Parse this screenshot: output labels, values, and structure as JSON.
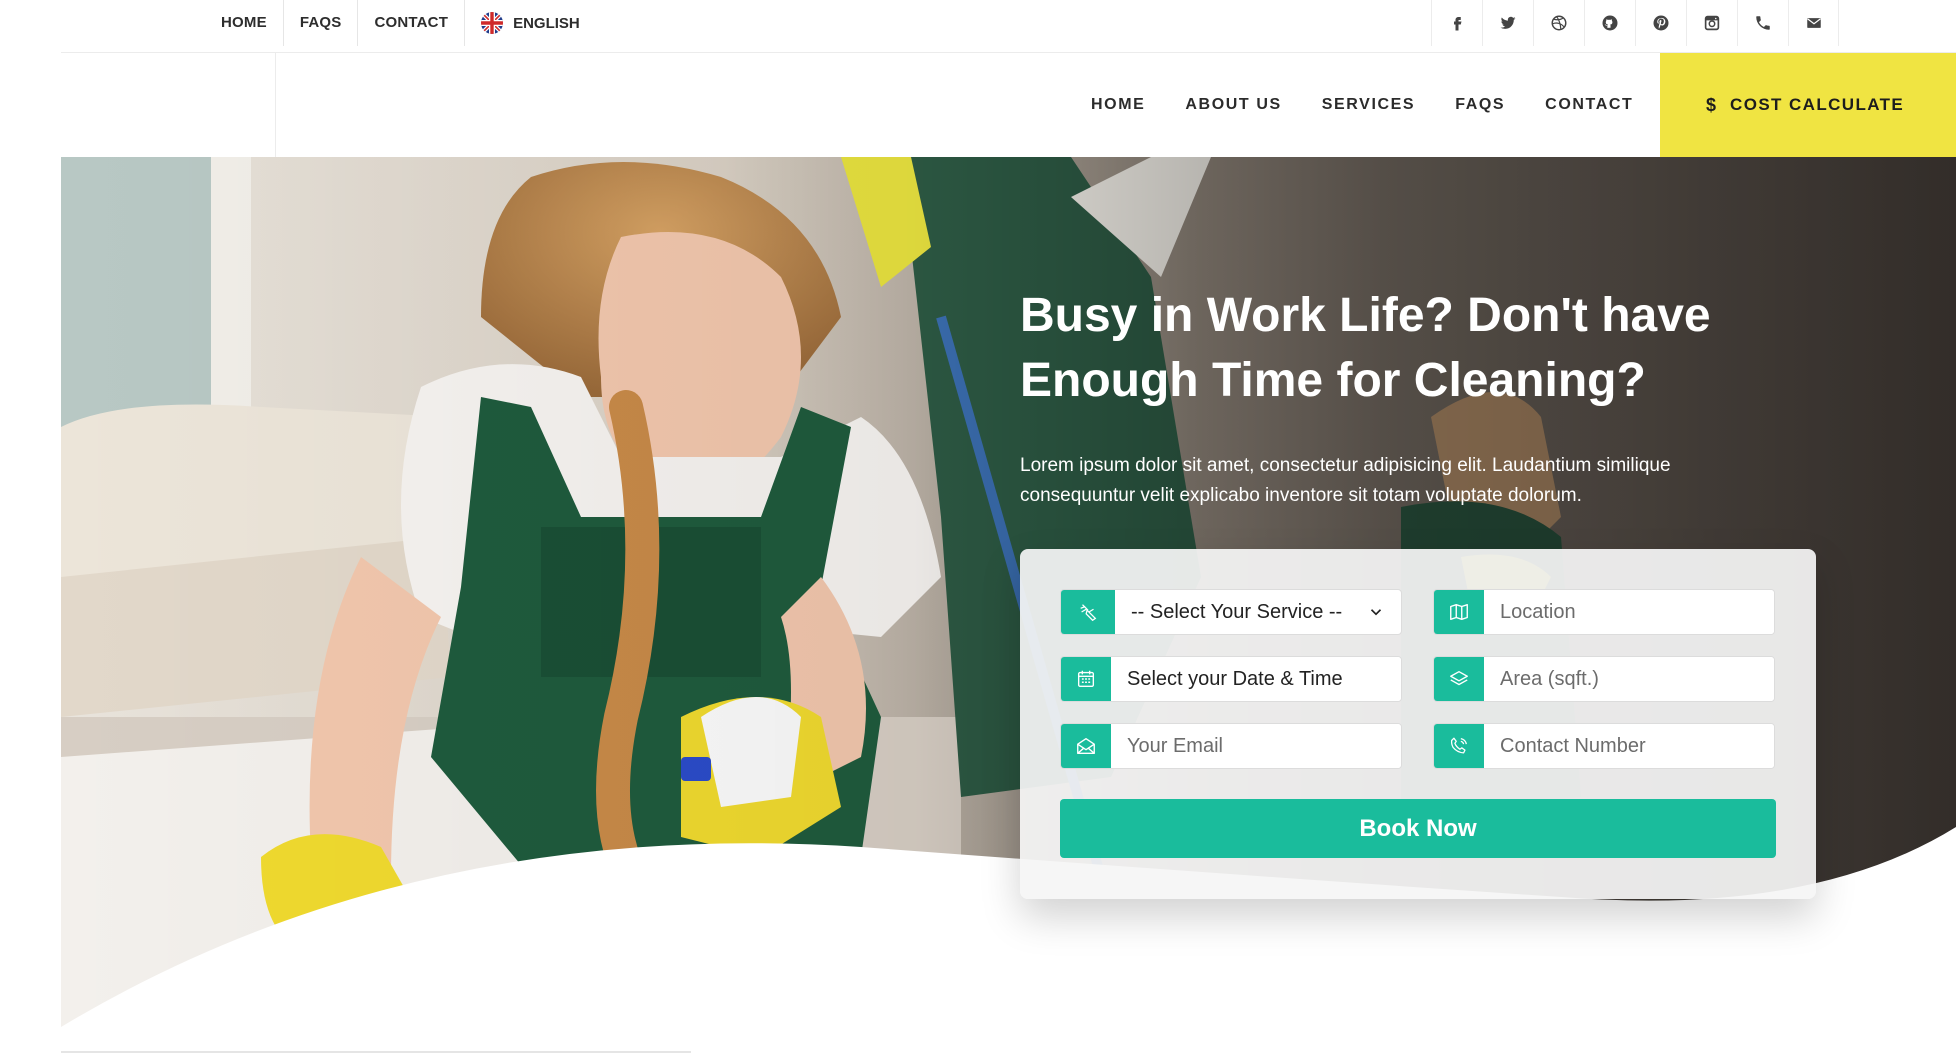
{
  "topbar": {
    "links": [
      "HOME",
      "FAQS",
      "CONTACT"
    ],
    "language": "ENGLISH",
    "socials": [
      "facebook-icon",
      "twitter-icon",
      "dribbble-icon",
      "github-icon",
      "pinterest-icon",
      "instagram-icon",
      "phone-icon",
      "envelope-icon"
    ]
  },
  "header": {
    "nav": [
      "HOME",
      "ABOUT US",
      "SERVICES",
      "FAQS",
      "CONTACT"
    ],
    "cta": {
      "icon": "$",
      "label": "COST CALCULATE"
    }
  },
  "hero": {
    "title": "Busy in Work Life? Don't have Enough Time for Cleaning?",
    "text": "Lorem ipsum dolor sit amet, consectetur adipisicing elit. Laudantium similique consequuntur velit explicabo inventore sit totam voluptate dolorum."
  },
  "booking": {
    "service_select": "-- Select Your Service --",
    "location_placeholder": "Location",
    "datetime_value": "Select your Date & Time",
    "area_placeholder": "Area (sqft.)",
    "email_placeholder": "Your Email",
    "contact_placeholder": "Contact Number",
    "submit_label": "Book Now"
  },
  "colors": {
    "accent": "#1abc9c",
    "cta_yellow": "#f0e442"
  }
}
